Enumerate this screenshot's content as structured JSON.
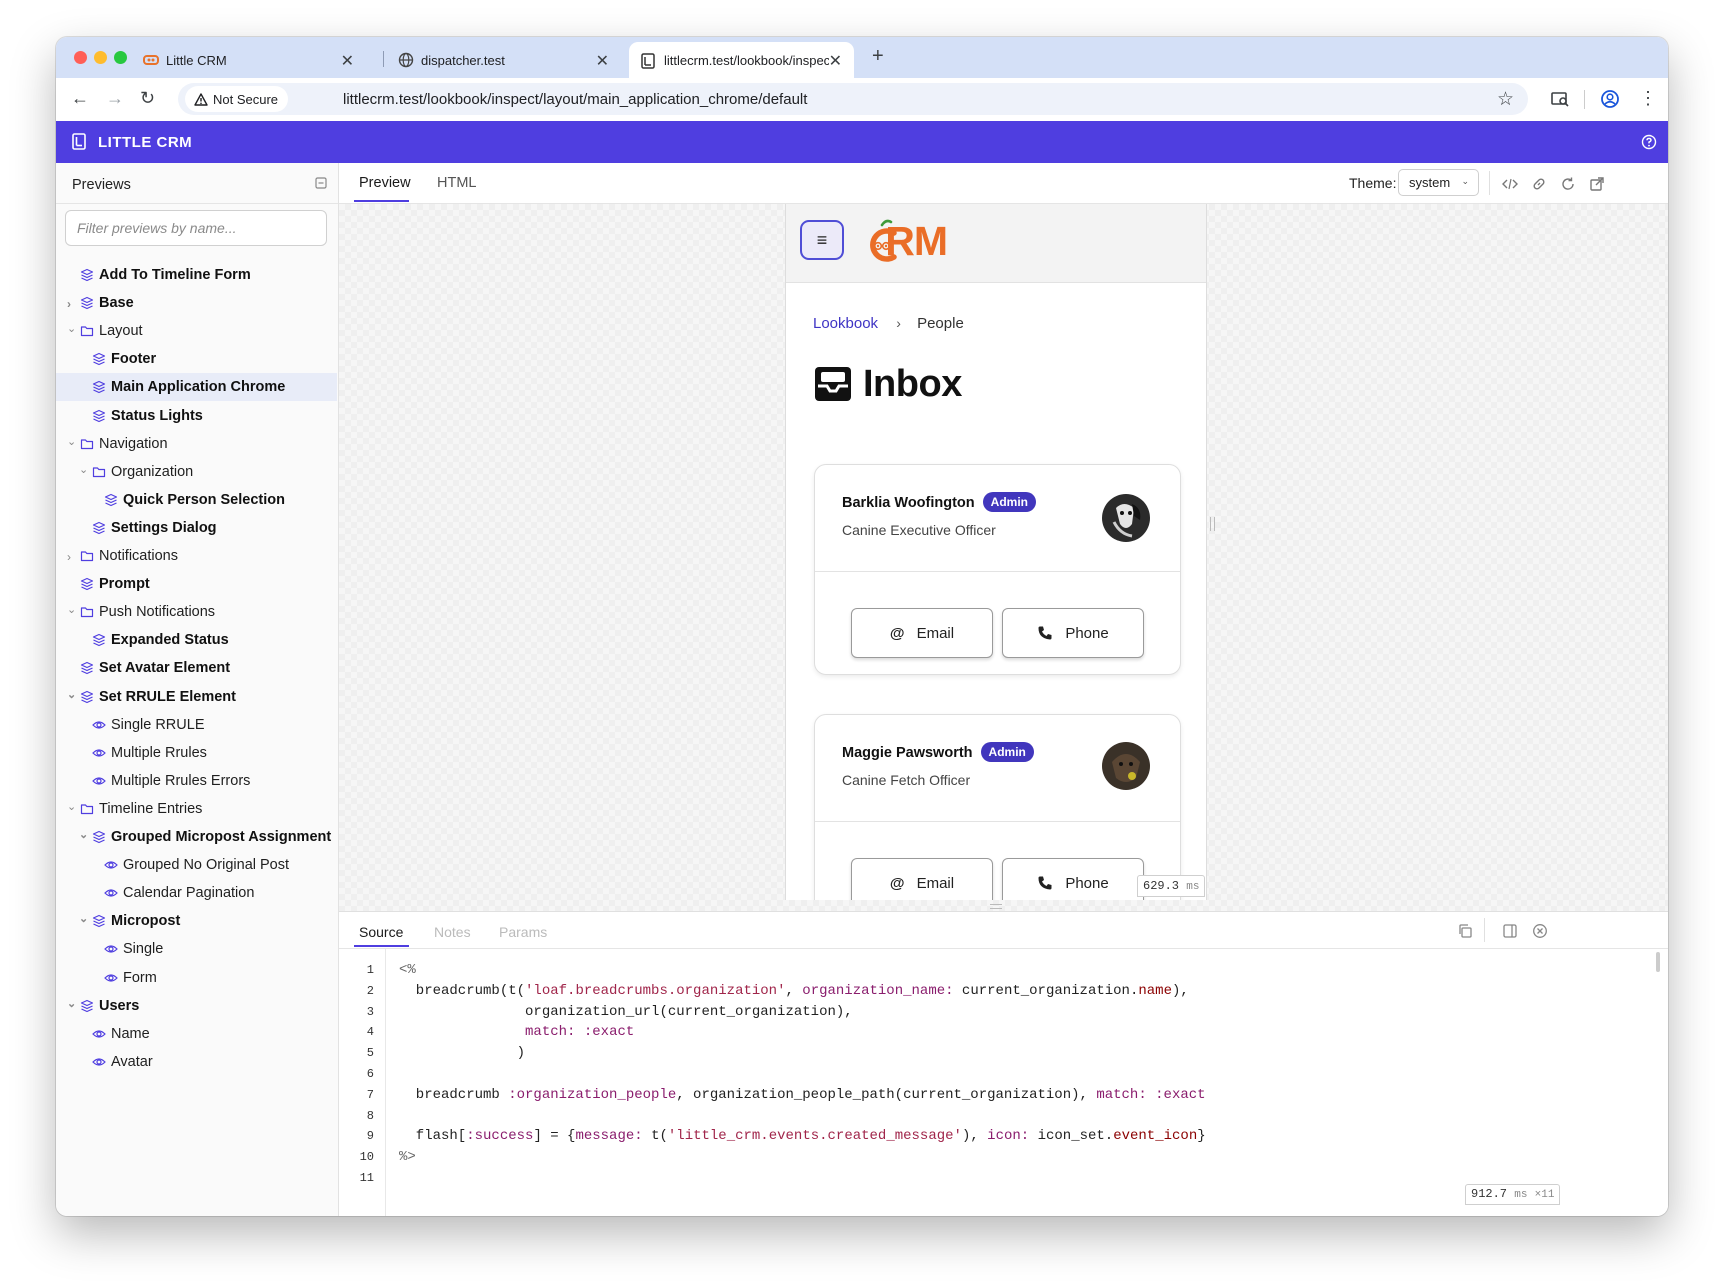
{
  "browser": {
    "tabs": [
      {
        "title": "Little CRM",
        "active": false
      },
      {
        "title": "dispatcher.test",
        "active": false
      },
      {
        "title": "littlecrm.test/lookbook/inspec",
        "active": true
      }
    ],
    "security_label": "Not Secure",
    "url": "littlecrm.test/lookbook/inspect/layout/main_application_chrome/default"
  },
  "app": {
    "title": "LITTLE CRM",
    "accent": "#4f3ee0"
  },
  "sidebar": {
    "title": "Previews",
    "filter_placeholder": "Filter previews by name...",
    "items": [
      {
        "label": "Add To Timeline Form"
      },
      {
        "label": "Base"
      },
      {
        "label": "Layout"
      },
      {
        "label": "Footer"
      },
      {
        "label": "Main Application Chrome"
      },
      {
        "label": "Status Lights"
      },
      {
        "label": "Navigation"
      },
      {
        "label": "Organization"
      },
      {
        "label": "Quick Person Selection"
      },
      {
        "label": "Settings Dialog"
      },
      {
        "label": "Notifications"
      },
      {
        "label": "Prompt"
      },
      {
        "label": "Push Notifications"
      },
      {
        "label": "Expanded Status"
      },
      {
        "label": "Set Avatar Element"
      },
      {
        "label": "Set RRULE Element"
      },
      {
        "label": "Single RRULE"
      },
      {
        "label": "Multiple Rrules"
      },
      {
        "label": "Multiple Rrules Errors"
      },
      {
        "label": "Timeline Entries"
      },
      {
        "label": "Grouped Micropost Assignment"
      },
      {
        "label": "Grouped No Original Post"
      },
      {
        "label": "Calendar Pagination"
      },
      {
        "label": "Micropost"
      },
      {
        "label": "Single"
      },
      {
        "label": "Form"
      },
      {
        "label": "Users"
      },
      {
        "label": "Name"
      },
      {
        "label": "Avatar"
      }
    ]
  },
  "main": {
    "tabs": [
      "Preview",
      "HTML"
    ],
    "theme_label": "Theme:",
    "theme_value": "system",
    "render_time": "629.3",
    "render_unit": "ms"
  },
  "preview": {
    "logo_text": "CRM",
    "breadcrumb": {
      "first": "Lookbook",
      "second": "People"
    },
    "heading": "Inbox",
    "people": [
      {
        "name": "Barklia Woofington",
        "badge": "Admin",
        "role": "Canine Executive Officer",
        "email_label": "Email",
        "phone_label": "Phone"
      },
      {
        "name": "Maggie Pawsworth",
        "badge": "Admin",
        "role": "Canine Fetch Officer",
        "email_label": "Email",
        "phone_label": "Phone"
      }
    ]
  },
  "panel": {
    "tabs": [
      "Source",
      "Notes",
      "Params"
    ],
    "render_time": "912.7",
    "render_unit": "ms",
    "render_count": "×11",
    "line_numbers": [
      "1",
      "2",
      "3",
      "4",
      "5",
      "6",
      "7",
      "8",
      "9",
      "10",
      "11"
    ]
  }
}
